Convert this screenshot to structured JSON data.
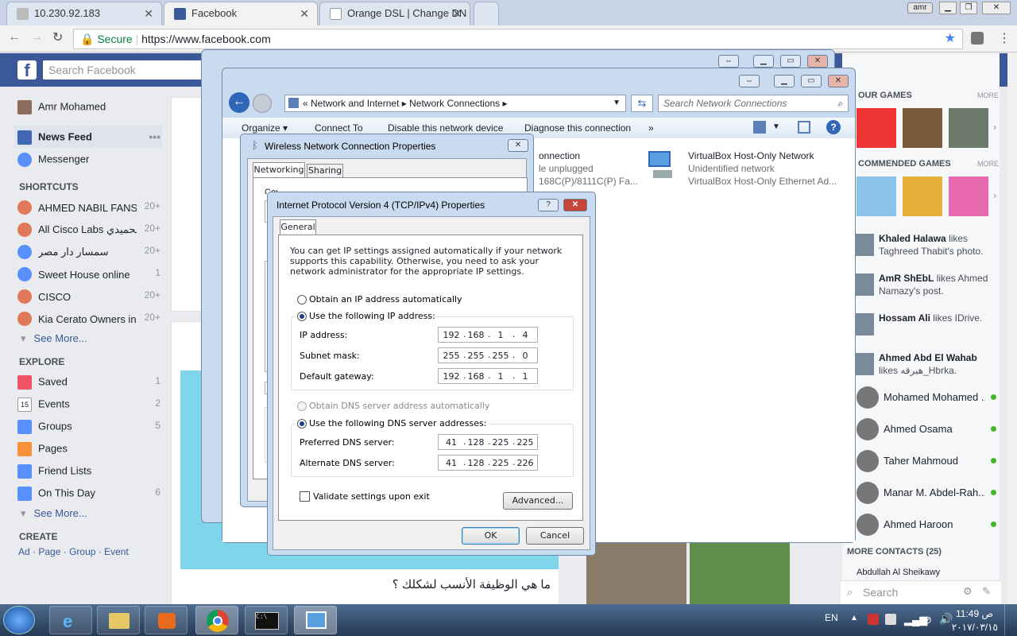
{
  "browser": {
    "tabs": [
      {
        "label": "10.230.92.183"
      },
      {
        "label": "Facebook"
      },
      {
        "label": "Orange DSL | Change DN"
      }
    ],
    "user_badge": "amr",
    "secure_label": "Secure",
    "url": "https://www.facebook.com"
  },
  "facebook": {
    "search_placeholder": "Search Facebook",
    "profile_name": "Amr Mohamed",
    "nav": [
      {
        "label": "News Feed"
      },
      {
        "label": "Messenger"
      }
    ],
    "shortcuts_heading": "SHORTCUTS",
    "shortcuts": [
      {
        "label": "AHMED NABIL FANS",
        "count": "20+"
      },
      {
        "label": "All Cisco Labs الحميدي ...",
        "count": "20+"
      },
      {
        "label": "سمسار دار مصر",
        "count": "20+"
      },
      {
        "label": "Sweet House online",
        "count": "1"
      },
      {
        "label": "CISCO",
        "count": "20+"
      },
      {
        "label": "Kia Cerato Owners in...",
        "count": "20+"
      }
    ],
    "see_more": "See More...",
    "explore_heading": "EXPLORE",
    "explore": [
      {
        "label": "Saved",
        "count": "1"
      },
      {
        "label": "Events",
        "count": "2"
      },
      {
        "label": "Groups",
        "count": "5"
      },
      {
        "label": "Pages",
        "count": ""
      },
      {
        "label": "Friend Lists",
        "count": ""
      },
      {
        "label": "On This Day",
        "count": "6"
      }
    ],
    "events_icon_number": "15",
    "create_heading": "CREATE",
    "create_links": [
      "Ad",
      "Page",
      "Group",
      "Event"
    ],
    "your_games": "OUR GAMES",
    "recommended_games": "COMMENDED GAMES",
    "more": "MORE",
    "ticker": [
      {
        "name": "Khaled Halawa",
        "text": "likes Taghreed Thabit's photo."
      },
      {
        "name": "AmR ShEbL",
        "text": "likes Ahmed Namazy's post."
      },
      {
        "name": "Hossam Ali",
        "text": "likes IDrive."
      },
      {
        "name": "Ahmed Abd El Wahab",
        "text": "likes هبرقه_Hbrka."
      }
    ],
    "contacts": [
      "Mohamed Mohamed ...",
      "Ahmed Osama",
      "Taher Mahmoud",
      "Manar M. Abdel-Rah...",
      "Ahmed Haroon"
    ],
    "more_contacts": "MORE CONTACTS (25)",
    "partial_contact": "Abdullah Al Sheikawy",
    "chat_search": "Search",
    "post_arabic_title": "ما هي الوظيفة الأنسب لشكلك ؟"
  },
  "network_connections": {
    "breadcrumb": [
      "Network and Internet",
      "Network Connections"
    ],
    "search_placeholder": "Search Network Connections",
    "toolbar": [
      "Organize ▾",
      "Connect To",
      "Disable this network device",
      "Diagnose this connection",
      "»"
    ],
    "items": [
      {
        "name": "onnection",
        "status": "le unplugged",
        "device": "168C(P)/8111C(P) Fa..."
      },
      {
        "name": "VirtualBox Host-Only Network",
        "status": "Unidentified network",
        "device": "VirtualBox Host-Only Ethernet Ad..."
      }
    ]
  },
  "wireless_props": {
    "title": "Wireless Network Connection Properties",
    "tabs": [
      "Networking",
      "Sharing"
    ],
    "partial_label": "Connect using:"
  },
  "ipv4_dialog": {
    "title": "Internet Protocol Version 4 (TCP/IPv4) Properties",
    "help_button": "?",
    "close_button": "✕",
    "tab": "General",
    "description": "You can get IP settings assigned automatically if your network supports this capability. Otherwise, you need to ask your network administrator for the appropriate IP settings.",
    "obtain_ip_auto": "Obtain an IP address automatically",
    "use_following_ip": "Use the following IP address:",
    "ip_label": "IP address:",
    "ip": [
      "192",
      "168",
      "1",
      "4"
    ],
    "subnet_label": "Subnet mask:",
    "subnet": [
      "255",
      "255",
      "255",
      "0"
    ],
    "gateway_label": "Default gateway:",
    "gateway": [
      "192",
      "168",
      "1",
      "1"
    ],
    "obtain_dns_auto": "Obtain DNS server address automatically",
    "use_following_dns": "Use the following DNS server addresses:",
    "preferred_label": "Preferred DNS server:",
    "preferred": [
      "41",
      "128",
      "225",
      "225"
    ],
    "alternate_label": "Alternate DNS server:",
    "alternate": [
      "41",
      "128",
      "225",
      "226"
    ],
    "validate_label": "Validate settings upon exit",
    "advanced_button": "Advanced...",
    "ok_button": "OK",
    "cancel_button": "Cancel"
  },
  "taskbar": {
    "language": "EN",
    "time": "11:49 ص",
    "date": "٢٠١٧/٠٣/١٥"
  }
}
